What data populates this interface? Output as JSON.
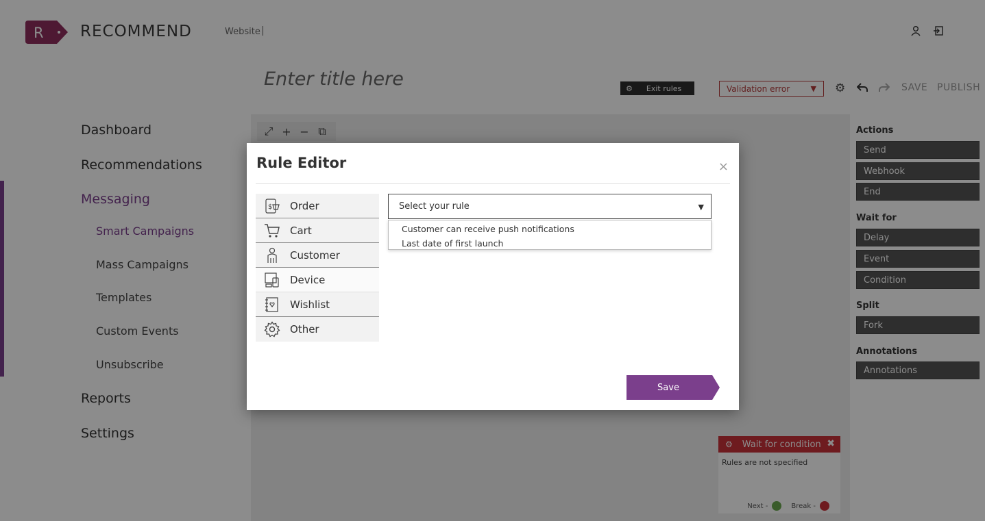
{
  "brand": {
    "logo_letter": "R",
    "name": "RECOMMEND",
    "accent_color": "#7b3f8c"
  },
  "header": {
    "site_label": "Website"
  },
  "nav": {
    "dashboard": "Dashboard",
    "recommendations": "Recommendations",
    "messaging": "Messaging",
    "sub": {
      "smart_campaigns": "Smart Campaigns",
      "mass_campaigns": "Mass Campaigns",
      "templates": "Templates",
      "custom_events": "Custom Events",
      "unsubscribe": "Unsubscribe"
    },
    "reports": "Reports",
    "settings": "Settings"
  },
  "editor": {
    "title_placeholder": "Enter title here",
    "exit_rules": "Exit rules",
    "validation": "Validation error",
    "save": "SAVE",
    "publish": "PUBLISH"
  },
  "palette": {
    "actions_heading": "Actions",
    "actions": [
      "Send",
      "Webhook",
      "End"
    ],
    "wait_heading": "Wait for",
    "wait": [
      "Delay",
      "Event",
      "Condition"
    ],
    "split_heading": "Split",
    "split": [
      "Fork"
    ],
    "annotations_heading": "Annotations",
    "annotations": [
      "Annotations"
    ]
  },
  "node": {
    "title": "Wait for condition",
    "body": "Rules are not specified",
    "next": "Next -",
    "break": "Break -",
    "header_color": "#c9323a",
    "next_color": "#6aa84f",
    "break_color": "#c9323a"
  },
  "modal": {
    "title": "Rule Editor",
    "close": "×",
    "categories": [
      "Order",
      "Cart",
      "Customer",
      "Device",
      "Wishlist",
      "Other"
    ],
    "selected_category": "Device",
    "select_placeholder": "Select your rule",
    "options": [
      "Customer can receive push notifications",
      "Last date of first launch"
    ],
    "save": "Save"
  }
}
